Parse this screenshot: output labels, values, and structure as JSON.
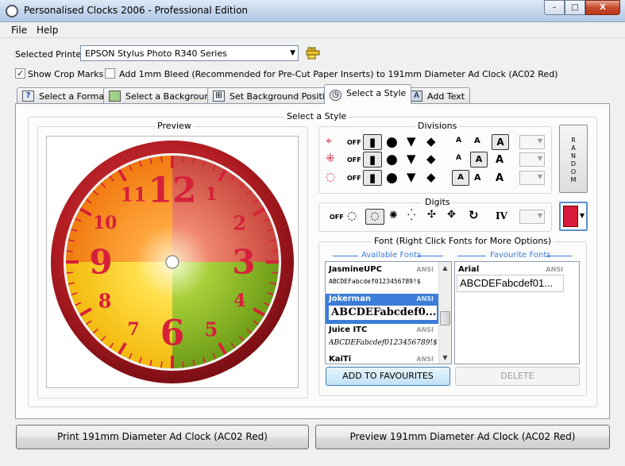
{
  "window": {
    "title": "Personalised Clocks 2006 - Professional Edition",
    "buttons": {
      "minimize": "–",
      "maximize": "□",
      "close": "X"
    }
  },
  "menu": [
    "File",
    "Help"
  ],
  "printer": {
    "label": "Selected Printer",
    "value": "EPSON Stylus Photo R340 Series"
  },
  "options": {
    "show_crop_marks": {
      "label": "Show Crop Marks",
      "checked": true
    },
    "add_bleed": {
      "label": "Add 1mm Bleed (Recommended for Pre-Cut Paper Inserts) to 191mm Diameter Ad Clock (AC02 Red)",
      "checked": false
    }
  },
  "tabs": [
    {
      "label": "Select a Format",
      "icon": "question-icon",
      "active": false
    },
    {
      "label": "Select a Background",
      "icon": "image-icon",
      "active": false
    },
    {
      "label": "Set Background Position",
      "icon": "position-icon",
      "active": false
    },
    {
      "label": "Select a Style",
      "icon": "clock-icon",
      "active": true
    },
    {
      "label": "Add Text",
      "icon": "text-icon",
      "active": false
    }
  ],
  "style_panel": {
    "title": "Select a Style",
    "preview_title": "Preview",
    "divisions_title": "Divisions",
    "off_label": "OFF",
    "random_label": "RANDOM",
    "digits_title": "Digits",
    "digits_roman": "IV",
    "numeral_letter": "A",
    "accent_color": "#d81b3c"
  },
  "clock": {
    "numerals": [
      "12",
      "1",
      "2",
      "3",
      "4",
      "5",
      "6",
      "7",
      "8",
      "9",
      "10",
      "11"
    ],
    "rim_color": "#b01c22",
    "numeral_color": "#d6203a"
  },
  "fonts": {
    "title": "Font (Right Click Fonts for More Options)",
    "available_title": "Available Fonts",
    "favourite_title": "Favourite Fonts",
    "available": [
      {
        "name": "JasmineUPC",
        "charset": "ANSI",
        "sample": "ABCDEFabcdef0123456789!$"
      },
      {
        "name": "Jokerman",
        "charset": "ANSI",
        "sample": "ABCDEFabcdef0..."
      },
      {
        "name": "Juice ITC",
        "charset": "ANSI",
        "sample": "ABCDEFabcdef0123456789!$"
      },
      {
        "name": "KaiTi",
        "charset": "ANSI",
        "sample": ""
      }
    ],
    "favourites": [
      {
        "name": "Arial",
        "charset": "ANSI",
        "sample": "ABCDEFabcdef01..."
      }
    ],
    "add_button": "ADD TO FAVOURITES",
    "delete_button": "DELETE"
  },
  "actions": {
    "print_button": "Print 191mm Diameter Ad Clock (AC02 Red)",
    "preview_button": "Preview 191mm Diameter Ad Clock (AC02 Red)"
  }
}
